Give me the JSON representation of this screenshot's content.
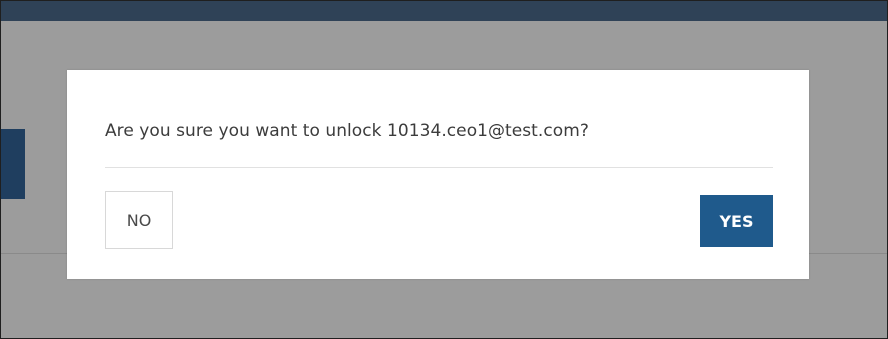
{
  "dialog": {
    "message": "Are you sure you want to unlock 10134.ceo1@test.com?",
    "no_label": "NO",
    "yes_label": "YES"
  },
  "colors": {
    "topbar": "#2f4257",
    "backdrop": "#9c9c9c",
    "yes_button": "#1f5a8c",
    "no_button_border": "#d8d8d8",
    "message_text": "#3c3c3c"
  }
}
